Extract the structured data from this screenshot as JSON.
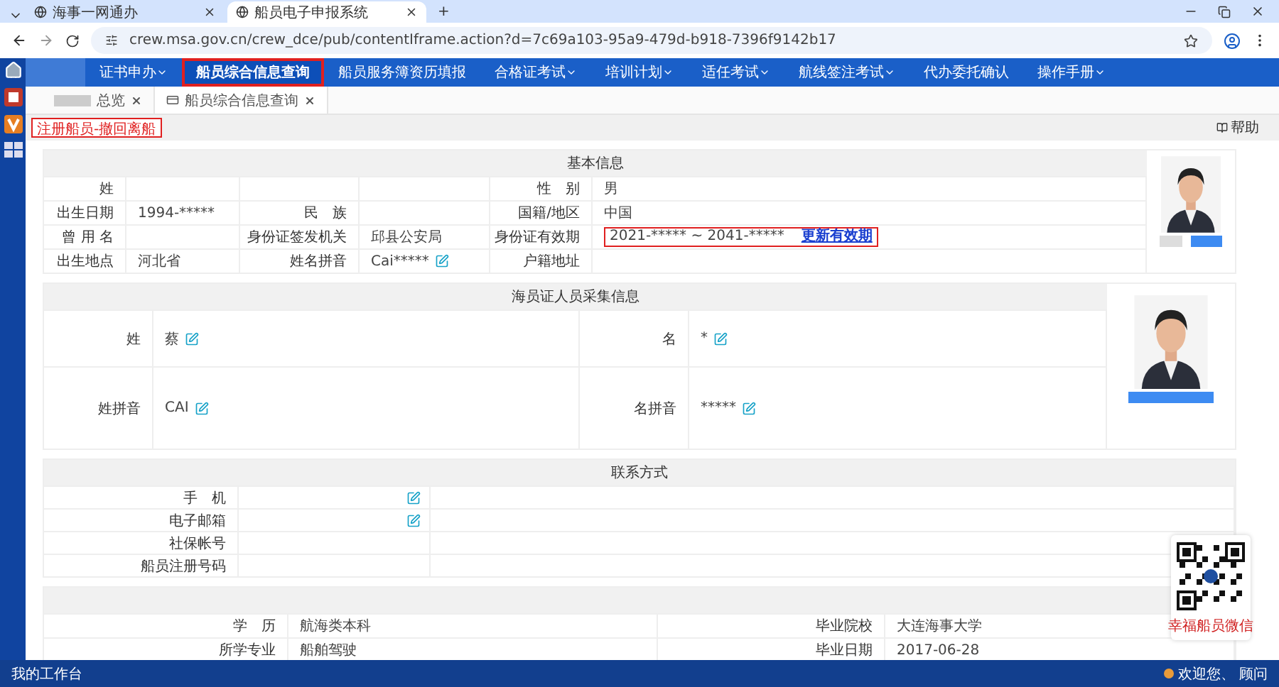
{
  "browser": {
    "tabs": [
      {
        "title": "海事一网通办",
        "selected": false
      },
      {
        "title": "船员电子申报系统",
        "selected": true
      }
    ],
    "new_tab": "+",
    "url": "crew.msa.gov.cn/crew_dce/pub/contentIframe.action?d=7c69a103-95a9-479d-b918-7396f9142b17"
  },
  "nav": {
    "items": [
      {
        "label": "证书申办",
        "selected": false,
        "dropdown": true
      },
      {
        "label": "船员综合信息查询",
        "selected": true,
        "dropdown": false
      },
      {
        "label": "船员服务簿资历填报",
        "selected": false,
        "dropdown": false
      },
      {
        "label": "合格证考试",
        "selected": false,
        "dropdown": true
      },
      {
        "label": "培训计划",
        "selected": false,
        "dropdown": true
      },
      {
        "label": "适任考试",
        "selected": false,
        "dropdown": true
      },
      {
        "label": "航线签注考试",
        "selected": false,
        "dropdown": true
      },
      {
        "label": "代办委托确认",
        "selected": false,
        "dropdown": false
      },
      {
        "label": "操作手册",
        "selected": false,
        "dropdown": true
      }
    ]
  },
  "page_tabs": [
    {
      "label": "总览",
      "selected": false
    },
    {
      "label": "船员综合信息查询",
      "selected": true
    }
  ],
  "toolbar": {
    "action_button": "注册船员-撤回离船",
    "help": "帮助"
  },
  "basic_info": {
    "title": "基本信息",
    "rows": [
      [
        {
          "label": "姓"
        },
        {},
        {
          "label": "性　别",
          "value": "男"
        }
      ],
      [
        {
          "label": "出生日期",
          "value": "1994-*****"
        },
        {
          "label": "民　族"
        },
        {
          "label": "国籍/地区",
          "value": "中国"
        }
      ],
      [
        {
          "label": "曾 用 名"
        },
        {
          "label": "身份证签发机关",
          "value": "邱县公安局"
        },
        {
          "label": "身份证有效期",
          "value": "2021-***** ~ 2041-*****",
          "link": "更新有效期",
          "annotated": true
        }
      ],
      [
        {
          "label": "出生地点",
          "value": "河北省"
        },
        {
          "label": "姓名拼音",
          "value": "Cai*****",
          "editable": true
        },
        {
          "label": "户籍地址"
        }
      ]
    ]
  },
  "seafarer_info": {
    "title": "海员证人员采集信息",
    "rows": [
      [
        {
          "label": "姓",
          "value": "蔡",
          "editable": true
        },
        {
          "label": "名",
          "value": "*",
          "editable": true
        }
      ],
      [
        {
          "label": "姓拼音",
          "value": "CAI",
          "editable": true
        },
        {
          "label": "名拼音",
          "value": "*****",
          "editable": true
        }
      ]
    ]
  },
  "contact": {
    "title": "联系方式",
    "rows": [
      {
        "label": "手　机",
        "editable": true
      },
      {
        "label": "电子邮箱",
        "editable": true
      },
      {
        "label": "社保帐号",
        "editable": false
      },
      {
        "label": "船员注册号码",
        "editable": false
      }
    ]
  },
  "education": {
    "rows": [
      [
        {
          "label": "学　历",
          "value": "航海类本科"
        },
        {
          "label": "毕业院校",
          "value": "大连海事大学"
        }
      ],
      [
        {
          "label": "所学专业",
          "value": "船舶驾驶"
        },
        {
          "label": "毕业日期",
          "value": "2017-06-28"
        }
      ]
    ]
  },
  "qr": {
    "caption": "幸福船员微信"
  },
  "status_bar": {
    "workspace": "我的工作台",
    "user": "欢迎您、 顾问"
  }
}
